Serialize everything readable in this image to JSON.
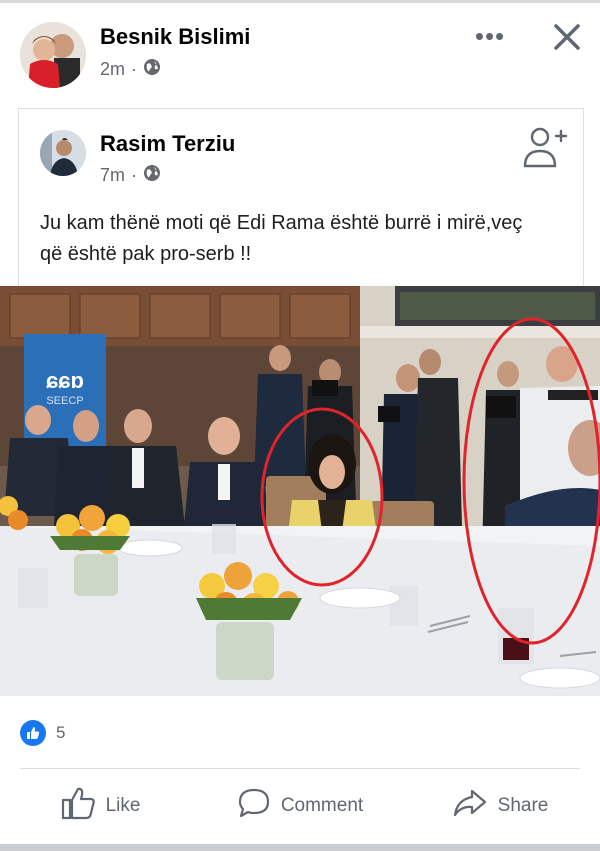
{
  "post": {
    "author": "Besnik Bislimi",
    "time": "2m",
    "privacy_icon": "globe-icon",
    "more_label": "•••",
    "close_icon": "close-icon"
  },
  "shared_post": {
    "author": "Rasim Terziu",
    "time": "7m",
    "privacy_icon": "globe-icon",
    "add_friend_icon": "add-friend-icon",
    "text": "Ju kam thënë moti që Edi Rama është burrë i mirë,veç që është pak pro-serb !!"
  },
  "photo": {
    "banner_logo": "SEECP"
  },
  "reactions": {
    "icon": "like-reaction-icon",
    "count": "5"
  },
  "actions": [
    {
      "label": "Like",
      "icon": "thumbs-up-icon"
    },
    {
      "label": "Comment",
      "icon": "comment-icon"
    },
    {
      "label": "Share",
      "icon": "share-icon"
    }
  ],
  "colors": {
    "brand_blue": "#1877f2",
    "secondary_text": "#65676b",
    "annotation_red": "#e0242b"
  }
}
